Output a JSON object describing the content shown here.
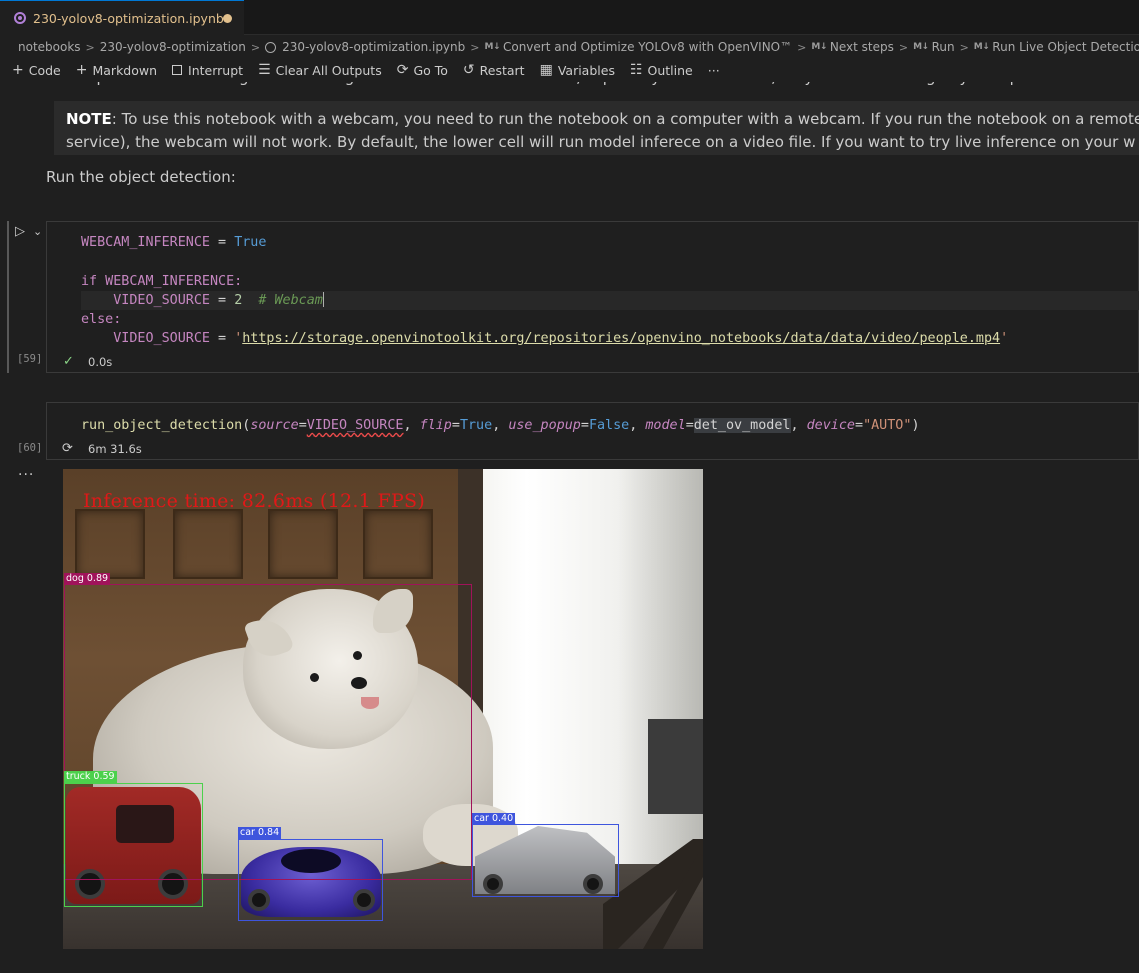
{
  "tab": {
    "title": "230-yolov8-optimization.ipynb"
  },
  "breadcrumbs": [
    "notebooks",
    "230-yolov8-optimization",
    "230-yolov8-optimization.ipynb",
    "Convert and Optimize YOLOv8 with OpenVINO™",
    "Next steps",
    "Run",
    "Run Live Object Detection and Se"
  ],
  "breadcrumb_md_marker": "M↓",
  "toolbar": {
    "code": "Code",
    "markdown": "Markdown",
    "interrupt": "Interrupt",
    "clear_all_outputs": "Clear All Outputs",
    "go_to": "Go To",
    "restart": "Restart",
    "variables": "Variables",
    "outline": "Outline",
    "more": "···"
  },
  "markdown": {
    "clipped_line": "Set `flip=True` when using a front-facing camera. Some web browsers, especially Mozilla Firefox, may cause flickering. If you experience flickering,",
    "note_label": "NOTE",
    "note_line1": ": To use this notebook with a webcam, you need to run the notebook on a computer with a webcam. If you run the notebook on a remote",
    "note_line2": "service), the webcam will not work. By default, the lower cell will run model inferece on a video file. If you want to try live inference on your w",
    "run_heading": "Run the object detection:"
  },
  "cell1": {
    "exec_count": "[59]",
    "status_time": "0.0s",
    "code": {
      "var_name": "WEBCAM_INFERENCE",
      "eq": " = ",
      "true": "True",
      "if_kw": "if",
      "if_cond": " WEBCAM_INFERENCE:",
      "indent": "    ",
      "source_var": "VIDEO_SOURCE",
      "source_value": "2",
      "comment": "  # Webcam",
      "else_kw": "else:",
      "url_quote": "'",
      "url": "https://storage.openvinotoolkit.org/repositories/openvino_notebooks/data/data/video/people.mp4"
    }
  },
  "cell2": {
    "exec_count": "[60]",
    "status_time": "6m 31.6s",
    "code": {
      "fn": "run_object_detection",
      "open": "(",
      "p1": "source",
      "v1": "VIDEO_SOURCE",
      "p2": "flip",
      "v2": "True",
      "p3": "use_popup",
      "v3": "False",
      "p4": "model",
      "v4": "det_ov_model",
      "p5": "device",
      "v5": "\"AUTO\"",
      "eq": "=",
      "comma": ", ",
      "close": ")"
    }
  },
  "output": {
    "ellipsis": "···",
    "inference_text": "Inference time: 82.6ms (12.1 FPS)",
    "detections": [
      {
        "label": "dog 0.89",
        "color": "#a0135a"
      },
      {
        "label": "truck 0.59",
        "color": "#4cd14c"
      },
      {
        "label": "car 0.84",
        "color": "#3e55dd"
      },
      {
        "label": "car 0.40",
        "color": "#3e55dd"
      }
    ]
  },
  "colors": {
    "background": "#1f1f1f",
    "accent": "#0078d4",
    "success": "#89d185",
    "tab_modified": "#e2c08d"
  }
}
